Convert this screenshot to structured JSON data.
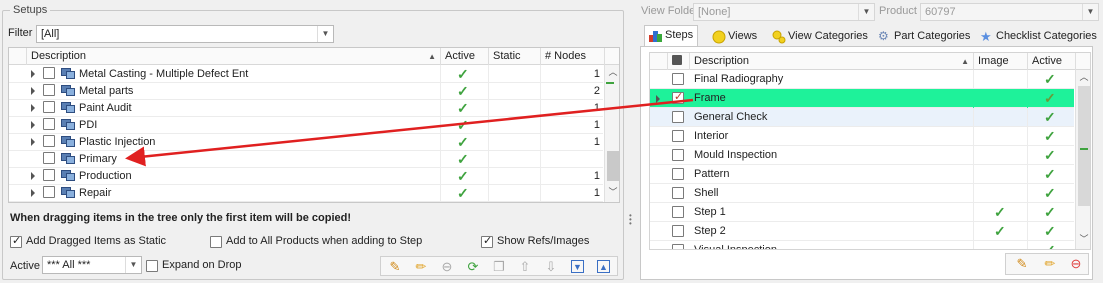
{
  "setups": {
    "group_title": "Setups",
    "filter_label": "Filter",
    "filter_value": "[All]",
    "columns": [
      "Description",
      "Active",
      "Static",
      "# Nodes"
    ],
    "rows": [
      {
        "label": "Metal Casting - Multiple Defect Ent",
        "active": true,
        "nodes": "1",
        "expandable": true
      },
      {
        "label": "Metal parts",
        "active": true,
        "nodes": "2",
        "expandable": true
      },
      {
        "label": "Paint Audit",
        "active": true,
        "nodes": "1",
        "expandable": true
      },
      {
        "label": "PDI",
        "active": true,
        "nodes": "1",
        "expandable": true
      },
      {
        "label": "Plastic Injection",
        "active": true,
        "nodes": "1",
        "expandable": true
      },
      {
        "label": "Primary",
        "active": true,
        "nodes": "",
        "expandable": false
      },
      {
        "label": "Production",
        "active": true,
        "nodes": "1",
        "expandable": true
      },
      {
        "label": "Repair",
        "active": true,
        "nodes": "1",
        "expandable": true
      }
    ],
    "note": "When dragging items in the tree only the first item will be copied!",
    "opt_static": "Add Dragged Items as Static",
    "opt_all_products": "Add to All Products when adding to Step",
    "opt_refs": "Show Refs/Images",
    "active_label": "Active",
    "active_value": "*** All ***",
    "expand_on_drop": "Expand on Drop"
  },
  "header_right": {
    "view_folder_label": "View Folder",
    "view_folder_value": "[None]",
    "product_label": "Product",
    "product_value": "60797"
  },
  "tabs": [
    {
      "label": "Steps",
      "icon": "steps-icon"
    },
    {
      "label": "Views",
      "icon": "views-icon"
    },
    {
      "label": "View Categories",
      "icon": "view-categories-icon"
    },
    {
      "label": "Part Categories",
      "icon": "part-categories-icon"
    },
    {
      "label": "Checklist Categories",
      "icon": "checklist-categories-icon"
    }
  ],
  "steps": {
    "columns": [
      "Description",
      "Image",
      "Active"
    ],
    "rows": [
      {
        "label": "Final Radiography",
        "image": false,
        "active": true
      },
      {
        "label": "Frame",
        "image": false,
        "active": true
      },
      {
        "label": "General Check",
        "image": false,
        "active": true
      },
      {
        "label": "Interior",
        "image": false,
        "active": true
      },
      {
        "label": "Mould Inspection",
        "image": false,
        "active": true
      },
      {
        "label": "Pattern",
        "image": false,
        "active": true
      },
      {
        "label": "Shell",
        "image": false,
        "active": true
      },
      {
        "label": "Step 1",
        "image": true,
        "active": true
      },
      {
        "label": "Step 2",
        "image": true,
        "active": true
      },
      {
        "label": "Visual Inspection",
        "image": false,
        "active": true
      }
    ]
  },
  "colors": {
    "selected_row": "#1ef29a",
    "drag_arrow": "#e02020",
    "check_green": "#3fa33f"
  }
}
